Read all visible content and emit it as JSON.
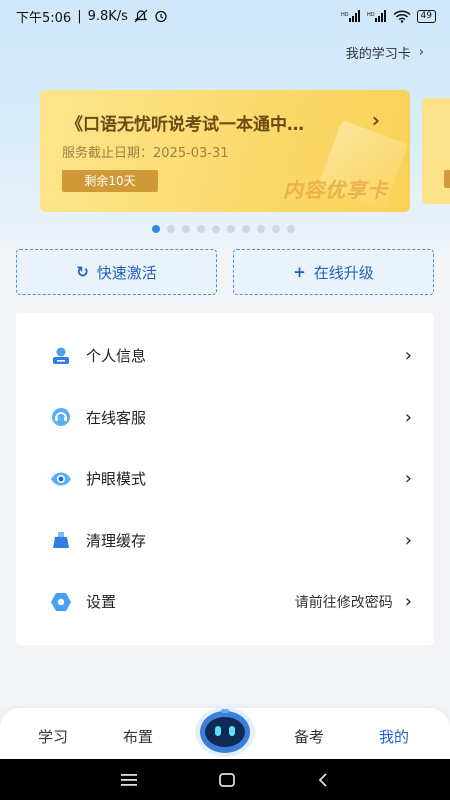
{
  "status_bar": {
    "time": "下午5:06",
    "speed": "9.8K/s",
    "battery": "49",
    "signal_label": "HD"
  },
  "header": {
    "my_cards_label": "我的学习卡"
  },
  "card": {
    "title": "《口语无忧听说考试一本通中…",
    "expiry_label": "服务截止日期：2025-03-31",
    "remaining": "剩余10天",
    "tag": "内容优享卡"
  },
  "carousel": {
    "total": 10,
    "active_index": 0
  },
  "actions": {
    "activate_label": "快速激活",
    "upgrade_label": "在线升级"
  },
  "menu": {
    "items": [
      {
        "label": "个人信息",
        "value": ""
      },
      {
        "label": "在线客服",
        "value": ""
      },
      {
        "label": "护眼模式",
        "value": ""
      },
      {
        "label": "清理缓存",
        "value": ""
      },
      {
        "label": "设置",
        "value": "请前往修改密码"
      }
    ]
  },
  "bottom_nav": {
    "items": [
      {
        "label": "学习",
        "active": false
      },
      {
        "label": "布置",
        "active": false
      },
      {
        "label": "备考",
        "active": false
      },
      {
        "label": "我的",
        "active": true
      }
    ]
  },
  "colors": {
    "accent": "#1e63d6",
    "card_gold": "#fbd96a",
    "badge": "#d19836"
  }
}
